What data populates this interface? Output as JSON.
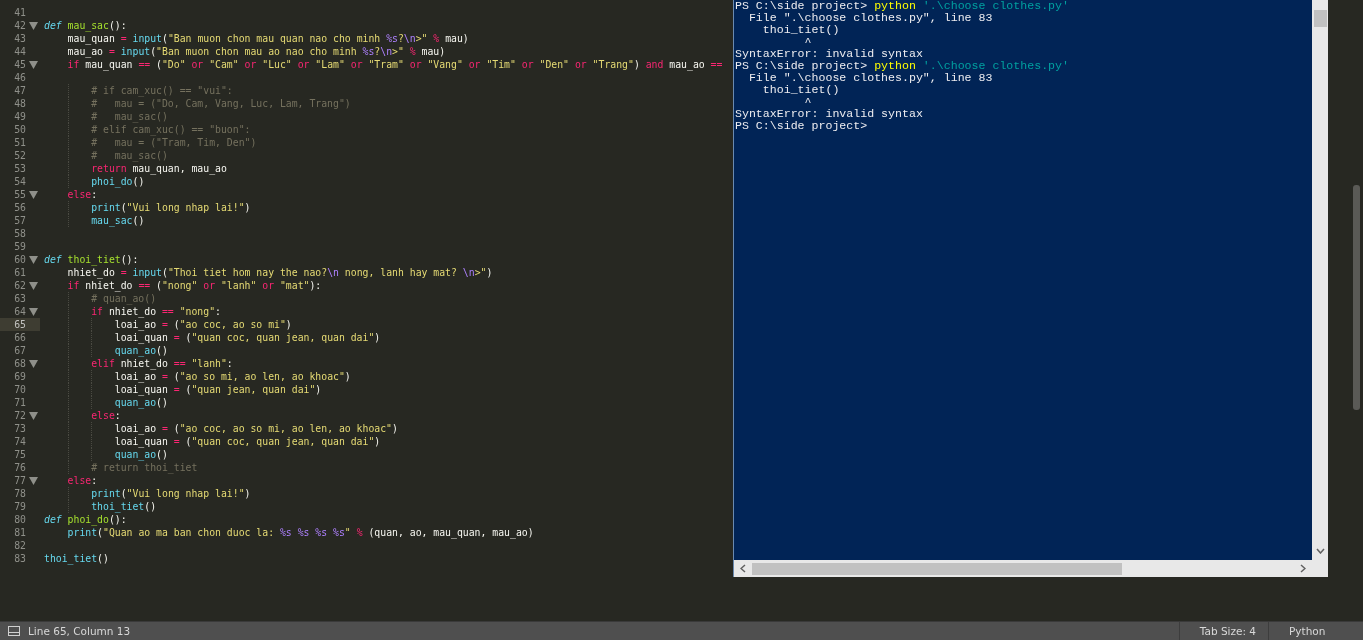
{
  "editor": {
    "lines": [
      {
        "n": "41",
        "fold": false,
        "current": false
      },
      {
        "n": "42",
        "fold": true,
        "current": false,
        "tokens": [
          {
            "kind": "def",
            "text": "def "
          },
          {
            "kind": "fn",
            "text": "mau_sac"
          },
          {
            "kind": "plain",
            "text": "():"
          }
        ]
      },
      {
        "n": "43",
        "fold": false,
        "current": false,
        "tokens": [
          {
            "kind": "plain",
            "text": "    mau_quan "
          },
          {
            "kind": "op",
            "text": "= "
          },
          {
            "kind": "call",
            "text": "input"
          },
          {
            "kind": "plain",
            "text": "("
          },
          {
            "kind": "str",
            "text": "\"Ban muon chon mau quan nao cho minh "
          },
          {
            "kind": "fmt",
            "text": "%s"
          },
          {
            "kind": "str",
            "text": "?"
          },
          {
            "kind": "fmt",
            "text": "\\n"
          },
          {
            "kind": "str",
            "text": ">\" "
          },
          {
            "kind": "op",
            "text": "%"
          },
          {
            "kind": "plain",
            "text": " mau)"
          }
        ]
      },
      {
        "n": "44",
        "fold": false,
        "current": false,
        "tokens": [
          {
            "kind": "plain",
            "text": "    mau_ao "
          },
          {
            "kind": "op",
            "text": "= "
          },
          {
            "kind": "call",
            "text": "input"
          },
          {
            "kind": "plain",
            "text": "("
          },
          {
            "kind": "str",
            "text": "\"Ban muon chon mau ao nao cho minh "
          },
          {
            "kind": "fmt",
            "text": "%s"
          },
          {
            "kind": "str",
            "text": "?"
          },
          {
            "kind": "fmt",
            "text": "\\n"
          },
          {
            "kind": "str",
            "text": ">\" "
          },
          {
            "kind": "op",
            "text": "%"
          },
          {
            "kind": "plain",
            "text": " mau)"
          }
        ]
      },
      {
        "n": "45",
        "fold": true,
        "current": false,
        "tokens": [
          {
            "kind": "kw",
            "text": "    if"
          },
          {
            "kind": "plain",
            "text": " mau_quan "
          },
          {
            "kind": "op",
            "text": "=="
          },
          {
            "kind": "plain",
            "text": " ("
          },
          {
            "kind": "str",
            "text": "\"Do\" "
          },
          {
            "kind": "kw",
            "text": "or"
          },
          {
            "kind": "str",
            "text": " \"Cam\" "
          },
          {
            "kind": "kw",
            "text": "or"
          },
          {
            "kind": "str",
            "text": " \"Luc\" "
          },
          {
            "kind": "kw",
            "text": "or"
          },
          {
            "kind": "str",
            "text": " \"Lam\" "
          },
          {
            "kind": "kw",
            "text": "or"
          },
          {
            "kind": "str",
            "text": " \"Tram\" "
          },
          {
            "kind": "kw",
            "text": "or"
          },
          {
            "kind": "str",
            "text": " \"Vang\" "
          },
          {
            "kind": "kw",
            "text": "or"
          },
          {
            "kind": "str",
            "text": " \"Tim\" "
          },
          {
            "kind": "kw",
            "text": "or"
          },
          {
            "kind": "str",
            "text": " \"Den\" "
          },
          {
            "kind": "kw",
            "text": "or"
          },
          {
            "kind": "str",
            "text": " \"Trang\""
          },
          {
            "kind": "plain",
            "text": ") "
          },
          {
            "kind": "kw",
            "text": "and"
          },
          {
            "kind": "plain",
            "text": " mau_ao "
          },
          {
            "kind": "op",
            "text": "=="
          }
        ]
      },
      {
        "n": "46",
        "fold": false,
        "current": false
      },
      {
        "n": "47",
        "fold": false,
        "current": false,
        "tokens": [
          {
            "kind": "cm",
            "text": "        # if cam_xuc() == \"vui\":"
          }
        ]
      },
      {
        "n": "48",
        "fold": false,
        "current": false,
        "tokens": [
          {
            "kind": "cm",
            "text": "        #   mau = (\"Do, Cam, Vang, Luc, Lam, Trang\")"
          }
        ]
      },
      {
        "n": "49",
        "fold": false,
        "current": false,
        "tokens": [
          {
            "kind": "cm",
            "text": "        #   mau_sac()"
          }
        ]
      },
      {
        "n": "50",
        "fold": false,
        "current": false,
        "tokens": [
          {
            "kind": "cm",
            "text": "        # elif cam_xuc() == \"buon\":"
          }
        ]
      },
      {
        "n": "51",
        "fold": false,
        "current": false,
        "tokens": [
          {
            "kind": "cm",
            "text": "        #   mau = (\"Tram, Tim, Den\")"
          }
        ]
      },
      {
        "n": "52",
        "fold": false,
        "current": false,
        "tokens": [
          {
            "kind": "cm",
            "text": "        #   mau_sac()"
          }
        ]
      },
      {
        "n": "53",
        "fold": false,
        "current": false,
        "tokens": [
          {
            "kind": "kw",
            "text": "        return"
          },
          {
            "kind": "plain",
            "text": " mau_quan, mau_ao"
          }
        ]
      },
      {
        "n": "54",
        "fold": false,
        "current": false,
        "tokens": [
          {
            "kind": "call",
            "text": "        phoi_do"
          },
          {
            "kind": "plain",
            "text": "()"
          }
        ]
      },
      {
        "n": "55",
        "fold": true,
        "current": false,
        "tokens": [
          {
            "kind": "kw",
            "text": "    else"
          },
          {
            "kind": "plain",
            "text": ":"
          }
        ]
      },
      {
        "n": "56",
        "fold": false,
        "current": false,
        "tokens": [
          {
            "kind": "call",
            "text": "        print"
          },
          {
            "kind": "plain",
            "text": "("
          },
          {
            "kind": "str",
            "text": "\"Vui long nhap lai!\""
          },
          {
            "kind": "plain",
            "text": ")"
          }
        ]
      },
      {
        "n": "57",
        "fold": false,
        "current": false,
        "tokens": [
          {
            "kind": "call",
            "text": "        mau_sac"
          },
          {
            "kind": "plain",
            "text": "()"
          }
        ]
      },
      {
        "n": "58",
        "fold": false,
        "current": false
      },
      {
        "n": "59",
        "fold": false,
        "current": false
      },
      {
        "n": "60",
        "fold": true,
        "current": false,
        "tokens": [
          {
            "kind": "def",
            "text": "def "
          },
          {
            "kind": "fn",
            "text": "thoi_tiet"
          },
          {
            "kind": "plain",
            "text": "():"
          }
        ]
      },
      {
        "n": "61",
        "fold": false,
        "current": false,
        "tokens": [
          {
            "kind": "plain",
            "text": "    nhiet_do "
          },
          {
            "kind": "op",
            "text": "= "
          },
          {
            "kind": "call",
            "text": "input"
          },
          {
            "kind": "plain",
            "text": "("
          },
          {
            "kind": "str",
            "text": "\"Thoi tiet hom nay the nao?"
          },
          {
            "kind": "fmt",
            "text": "\\n"
          },
          {
            "kind": "str",
            "text": " nong, lanh hay mat? "
          },
          {
            "kind": "fmt",
            "text": "\\n"
          },
          {
            "kind": "str",
            "text": ">\""
          },
          {
            "kind": "plain",
            "text": ")"
          }
        ]
      },
      {
        "n": "62",
        "fold": true,
        "current": false,
        "tokens": [
          {
            "kind": "kw",
            "text": "    if"
          },
          {
            "kind": "plain",
            "text": " nhiet_do "
          },
          {
            "kind": "op",
            "text": "=="
          },
          {
            "kind": "plain",
            "text": " ("
          },
          {
            "kind": "str",
            "text": "\"nong\" "
          },
          {
            "kind": "kw",
            "text": "or"
          },
          {
            "kind": "str",
            "text": " \"lanh\" "
          },
          {
            "kind": "kw",
            "text": "or"
          },
          {
            "kind": "str",
            "text": " \"mat\""
          },
          {
            "kind": "plain",
            "text": "):"
          }
        ]
      },
      {
        "n": "63",
        "fold": false,
        "current": false,
        "tokens": [
          {
            "kind": "cm",
            "text": "        # quan_ao()"
          }
        ]
      },
      {
        "n": "64",
        "fold": true,
        "current": false,
        "tokens": [
          {
            "kind": "kw",
            "text": "        if"
          },
          {
            "kind": "plain",
            "text": " nhiet_do "
          },
          {
            "kind": "op",
            "text": "=="
          },
          {
            "kind": "str",
            "text": " \"nong\""
          },
          {
            "kind": "plain",
            "text": ":"
          }
        ]
      },
      {
        "n": "65",
        "fold": false,
        "current": true,
        "tokens": [
          {
            "kind": "plain",
            "text": "            loai_ao "
          },
          {
            "kind": "op",
            "text": "="
          },
          {
            "kind": "plain",
            "text": " ("
          },
          {
            "kind": "str",
            "text": "\"ao coc, ao so mi\""
          },
          {
            "kind": "plain",
            "text": ")"
          }
        ]
      },
      {
        "n": "66",
        "fold": false,
        "current": false,
        "tokens": [
          {
            "kind": "plain",
            "text": "            loai_quan "
          },
          {
            "kind": "op",
            "text": "="
          },
          {
            "kind": "plain",
            "text": " ("
          },
          {
            "kind": "str",
            "text": "\"quan coc, quan jean, quan dai\""
          },
          {
            "kind": "plain",
            "text": ")"
          }
        ]
      },
      {
        "n": "67",
        "fold": false,
        "current": false,
        "tokens": [
          {
            "kind": "call",
            "text": "            quan_ao"
          },
          {
            "kind": "plain",
            "text": "()"
          }
        ]
      },
      {
        "n": "68",
        "fold": true,
        "current": false,
        "tokens": [
          {
            "kind": "kw",
            "text": "        elif"
          },
          {
            "kind": "plain",
            "text": " nhiet_do "
          },
          {
            "kind": "op",
            "text": "=="
          },
          {
            "kind": "str",
            "text": " \"lanh\""
          },
          {
            "kind": "plain",
            "text": ":"
          }
        ]
      },
      {
        "n": "69",
        "fold": false,
        "current": false,
        "tokens": [
          {
            "kind": "plain",
            "text": "            loai_ao "
          },
          {
            "kind": "op",
            "text": "="
          },
          {
            "kind": "plain",
            "text": " ("
          },
          {
            "kind": "str",
            "text": "\"ao so mi, ao len, ao khoac\""
          },
          {
            "kind": "plain",
            "text": ")"
          }
        ]
      },
      {
        "n": "70",
        "fold": false,
        "current": false,
        "tokens": [
          {
            "kind": "plain",
            "text": "            loai_quan "
          },
          {
            "kind": "op",
            "text": "="
          },
          {
            "kind": "plain",
            "text": " ("
          },
          {
            "kind": "str",
            "text": "\"quan jean, quan dai\""
          },
          {
            "kind": "plain",
            "text": ")"
          }
        ]
      },
      {
        "n": "71",
        "fold": false,
        "current": false,
        "tokens": [
          {
            "kind": "call",
            "text": "            quan_ao"
          },
          {
            "kind": "plain",
            "text": "()"
          }
        ]
      },
      {
        "n": "72",
        "fold": true,
        "current": false,
        "tokens": [
          {
            "kind": "kw",
            "text": "        else"
          },
          {
            "kind": "plain",
            "text": ":"
          }
        ]
      },
      {
        "n": "73",
        "fold": false,
        "current": false,
        "tokens": [
          {
            "kind": "plain",
            "text": "            loai_ao "
          },
          {
            "kind": "op",
            "text": "="
          },
          {
            "kind": "plain",
            "text": " ("
          },
          {
            "kind": "str",
            "text": "\"ao coc, ao so mi, ao len, ao khoac\""
          },
          {
            "kind": "plain",
            "text": ")"
          }
        ]
      },
      {
        "n": "74",
        "fold": false,
        "current": false,
        "tokens": [
          {
            "kind": "plain",
            "text": "            loai_quan "
          },
          {
            "kind": "op",
            "text": "="
          },
          {
            "kind": "plain",
            "text": " ("
          },
          {
            "kind": "str",
            "text": "\"quan coc, quan jean, quan dai\""
          },
          {
            "kind": "plain",
            "text": ")"
          }
        ]
      },
      {
        "n": "75",
        "fold": false,
        "current": false,
        "tokens": [
          {
            "kind": "call",
            "text": "            quan_ao"
          },
          {
            "kind": "plain",
            "text": "()"
          }
        ]
      },
      {
        "n": "76",
        "fold": false,
        "current": false,
        "tokens": [
          {
            "kind": "cm",
            "text": "        # return thoi_tiet"
          }
        ]
      },
      {
        "n": "77",
        "fold": true,
        "current": false,
        "tokens": [
          {
            "kind": "kw",
            "text": "    else"
          },
          {
            "kind": "plain",
            "text": ":"
          }
        ]
      },
      {
        "n": "78",
        "fold": false,
        "current": false,
        "tokens": [
          {
            "kind": "call",
            "text": "        print"
          },
          {
            "kind": "plain",
            "text": "("
          },
          {
            "kind": "str",
            "text": "\"Vui long nhap lai!\""
          },
          {
            "kind": "plain",
            "text": ")"
          }
        ]
      },
      {
        "n": "79",
        "fold": false,
        "current": false,
        "tokens": [
          {
            "kind": "call",
            "text": "        thoi_tiet"
          },
          {
            "kind": "plain",
            "text": "()"
          }
        ]
      },
      {
        "n": "80",
        "fold": false,
        "current": false,
        "tokens": [
          {
            "kind": "def",
            "text": "def "
          },
          {
            "kind": "fn",
            "text": "phoi_do"
          },
          {
            "kind": "plain",
            "text": "():"
          }
        ]
      },
      {
        "n": "81",
        "fold": false,
        "current": false,
        "tokens": [
          {
            "kind": "call",
            "text": "    print"
          },
          {
            "kind": "plain",
            "text": "("
          },
          {
            "kind": "str",
            "text": "\"Quan ao ma ban chon duoc la: "
          },
          {
            "kind": "fmt",
            "text": "%s %s %s %s"
          },
          {
            "kind": "str",
            "text": "\" "
          },
          {
            "kind": "op",
            "text": "%"
          },
          {
            "kind": "plain",
            "text": " (quan, ao, mau_quan, mau_ao)"
          }
        ]
      },
      {
        "n": "82",
        "fold": false,
        "current": false
      },
      {
        "n": "83",
        "fold": false,
        "current": false,
        "tokens": [
          {
            "kind": "call",
            "text": "thoi_tiet"
          },
          {
            "kind": "plain",
            "text": "()"
          }
        ]
      }
    ]
  },
  "terminal": {
    "lines": [
      [
        {
          "kind": "out",
          "text": "PS C:\\side project> "
        },
        {
          "kind": "cmd",
          "text": "python"
        },
        {
          "kind": "arg",
          "text": " '.\\choose clothes.py'"
        }
      ],
      [
        {
          "kind": "out",
          "text": "  File \".\\choose clothes.py\", line 83"
        }
      ],
      [
        {
          "kind": "out",
          "text": "    thoi_tiet()"
        }
      ],
      [
        {
          "kind": "out",
          "text": "          ^"
        }
      ],
      [
        {
          "kind": "out",
          "text": "SyntaxError: invalid syntax"
        }
      ],
      [
        {
          "kind": "out",
          "text": "PS C:\\side project> "
        },
        {
          "kind": "cmd",
          "text": "python"
        },
        {
          "kind": "arg",
          "text": " '.\\choose clothes.py'"
        }
      ],
      [
        {
          "kind": "out",
          "text": "  File \".\\choose clothes.py\", line 83"
        }
      ],
      [
        {
          "kind": "out",
          "text": "    thoi_tiet()"
        }
      ],
      [
        {
          "kind": "out",
          "text": "          ^"
        }
      ],
      [
        {
          "kind": "out",
          "text": "SyntaxError: invalid syntax"
        }
      ],
      [
        {
          "kind": "out",
          "text": "PS C:\\side project>"
        }
      ]
    ]
  },
  "status_bar": {
    "position": "Line 65, Column 13",
    "tab_size": "Tab Size: 4",
    "syntax": "Python"
  }
}
